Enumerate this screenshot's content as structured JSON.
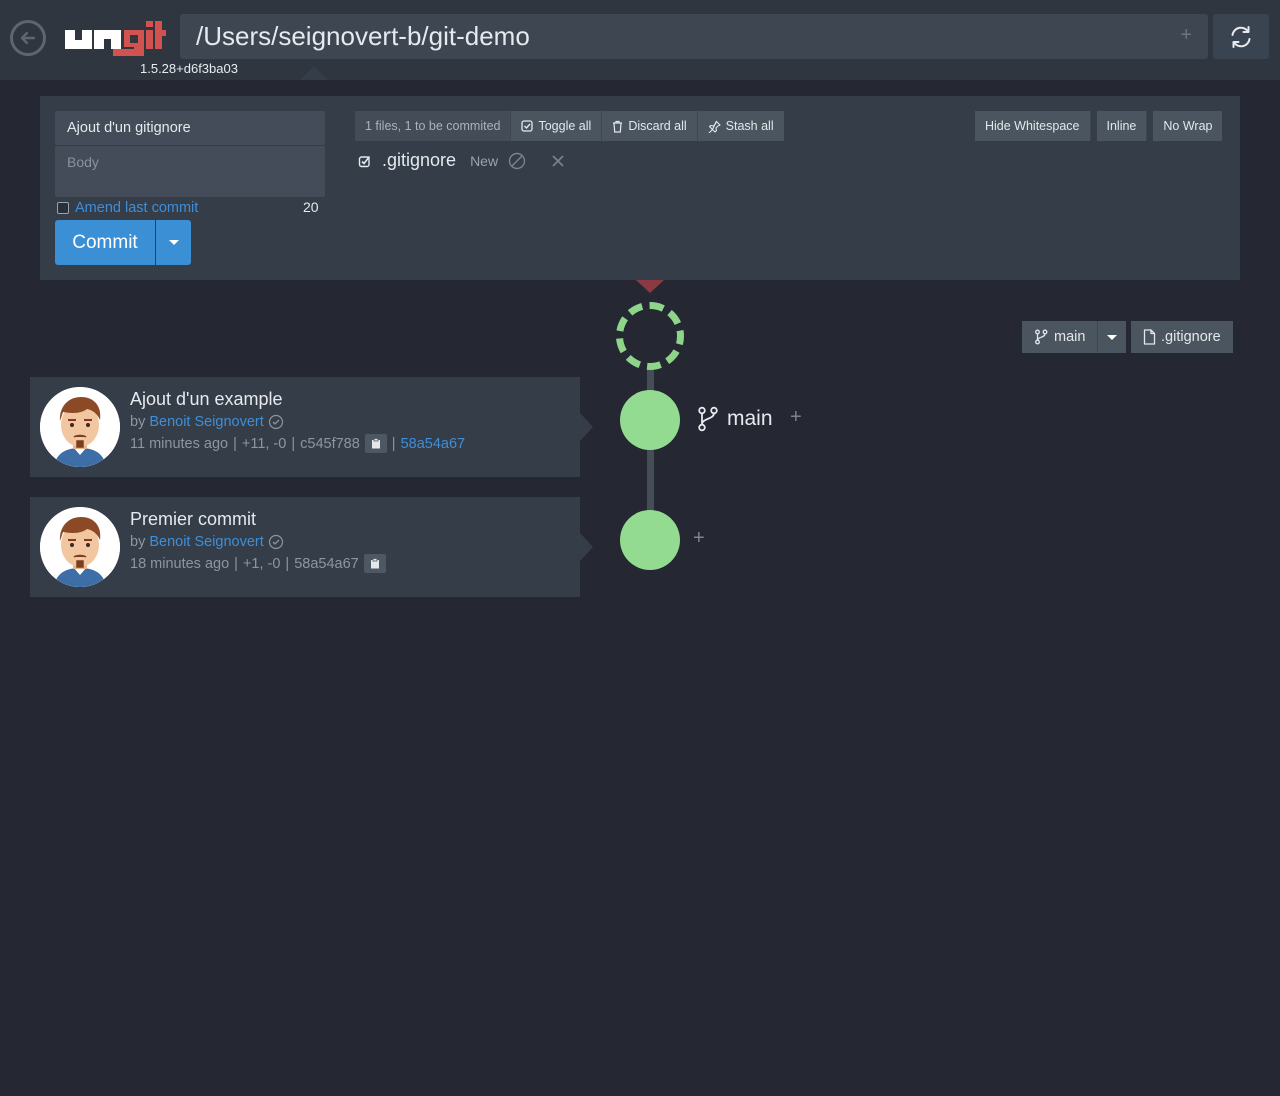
{
  "app": {
    "version": "1.5.28+d6f3ba03",
    "path": "/Users/seignovert-b/git-demo",
    "logo_text": "ungit"
  },
  "staging": {
    "title_value": "Ajout d'un gitignore",
    "body_placeholder": "Body",
    "amend_label": "Amend last commit",
    "char_count": "20",
    "commit_label": "Commit",
    "files_info": "1 files, 1 to be commited",
    "toggle_all": "Toggle all",
    "discard_all": "Discard all",
    "stash_all": "Stash all",
    "hide_whitespace": "Hide Whitespace",
    "inline": "Inline",
    "no_wrap": "No Wrap",
    "files": [
      {
        "name": ".gitignore",
        "status": "New"
      }
    ]
  },
  "graph": {
    "branch_name": "main",
    "branch_select": "main",
    "file_filter": ".gitignore"
  },
  "commits": [
    {
      "title": "Ajout d'un example",
      "by": "by",
      "author": "Benoit Seignovert",
      "time": "11 minutes ago",
      "diff": "+11, -0",
      "sha": "c545f788",
      "parent": "58a54a67"
    },
    {
      "title": "Premier commit",
      "by": "by",
      "author": "Benoit Seignovert",
      "time": "18 minutes ago",
      "diff": "+1, -0",
      "sha": "58a54a67"
    }
  ],
  "colors": {
    "background": "#252833",
    "panel": "#353d48",
    "accent_blue": "#3b8fd4",
    "node_green": "#93db90",
    "logo_red": "#d2524f"
  }
}
